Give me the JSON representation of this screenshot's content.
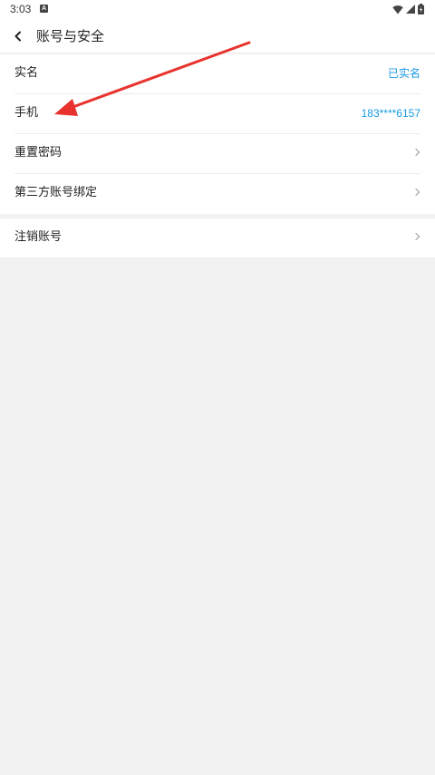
{
  "status_bar": {
    "time": "3:03",
    "notification_badge": "A",
    "icons": [
      "wifi-icon",
      "signal-icon",
      "battery-icon"
    ]
  },
  "header": {
    "title": "账号与安全",
    "back_icon": "chevron-left-icon"
  },
  "settings": {
    "rows": [
      {
        "label": "实名",
        "value": "已实名"
      },
      {
        "label": "手机",
        "value": "183****6157"
      },
      {
        "label": "重置密码"
      },
      {
        "label": "第三方账号绑定"
      }
    ],
    "cancel": {
      "label": "注销账号"
    }
  },
  "colors": {
    "accent": "#1a9be6",
    "annotation_arrow": "#e8322d",
    "background": "#f2f2f2"
  }
}
